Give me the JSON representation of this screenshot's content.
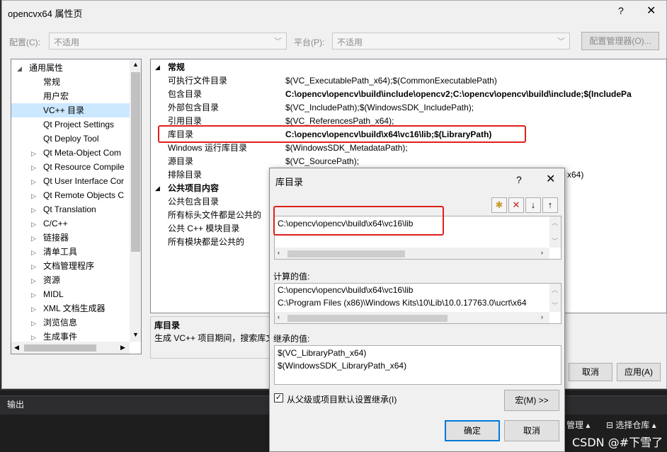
{
  "ide": {
    "output_tab": "输出",
    "status_mgmt": "管理 ▴",
    "status_repo": "⊟ 选择仓库 ▴",
    "watermark": "CSDN @#下雪了"
  },
  "prop_window": {
    "title": "opencvx64 属性页",
    "help": "?",
    "close": "✕",
    "config_label": "配置(C):",
    "config_value": "不适用",
    "platform_label": "平台(P):",
    "platform_value": "不适用",
    "config_manager": "配置管理器(O)...",
    "cancel": "取消",
    "apply": "应用(A)",
    "tree": [
      {
        "label": "通用属性",
        "expander": "◢",
        "level": 0
      },
      {
        "label": "常规",
        "expander": "",
        "level": 1
      },
      {
        "label": "用户宏",
        "expander": "",
        "level": 1
      },
      {
        "label": "VC++ 目录",
        "expander": "",
        "level": 1,
        "selected": true
      },
      {
        "label": "Qt Project Settings",
        "expander": "",
        "level": 1
      },
      {
        "label": "Qt Deploy Tool",
        "expander": "",
        "level": 1
      },
      {
        "label": "Qt Meta-Object Com",
        "expander": "▷",
        "level": 1
      },
      {
        "label": "Qt Resource Compile",
        "expander": "▷",
        "level": 1
      },
      {
        "label": "Qt User Interface Cor",
        "expander": "▷",
        "level": 1
      },
      {
        "label": "Qt Remote Objects C",
        "expander": "▷",
        "level": 1
      },
      {
        "label": "Qt Translation",
        "expander": "▷",
        "level": 1
      },
      {
        "label": "C/C++",
        "expander": "▷",
        "level": 1
      },
      {
        "label": "链接器",
        "expander": "▷",
        "level": 1
      },
      {
        "label": "清单工具",
        "expander": "▷",
        "level": 1
      },
      {
        "label": "文档管理程序",
        "expander": "▷",
        "level": 1
      },
      {
        "label": "资源",
        "expander": "▷",
        "level": 1
      },
      {
        "label": "MIDL",
        "expander": "▷",
        "level": 1
      },
      {
        "label": "XML 文档生成器",
        "expander": "▷",
        "level": 1
      },
      {
        "label": "浏览信息",
        "expander": "▷",
        "level": 1
      },
      {
        "label": "生成事件",
        "expander": "▷",
        "level": 1
      }
    ],
    "grid": [
      {
        "name": "常规",
        "value": "",
        "cat": true
      },
      {
        "name": "可执行文件目录",
        "value": "$(VC_ExecutablePath_x64);$(CommonExecutablePath)"
      },
      {
        "name": "包含目录",
        "value": "C:\\opencv\\opencv\\build\\include\\opencv2;C:\\opencv\\opencv\\build\\include;$(IncludePa",
        "bold": true
      },
      {
        "name": "外部包含目录",
        "value": "$(VC_IncludePath);$(WindowsSDK_IncludePath);"
      },
      {
        "name": "引用目录",
        "value": "$(VC_ReferencesPath_x64);"
      },
      {
        "name": "库目录",
        "value": "C:\\opencv\\opencv\\build\\x64\\vc16\\lib;$(LibraryPath)",
        "bold": true
      },
      {
        "name": "Windows 运行库目录",
        "value": "$(WindowsSDK_MetadataPath);"
      },
      {
        "name": "源目录",
        "value": "$(VC_SourcePath);"
      },
      {
        "name": "排除目录",
        "value": "x64)"
      },
      {
        "name": "公共项目内容",
        "value": "",
        "cat": true
      },
      {
        "name": "公共包含目录",
        "value": ""
      },
      {
        "name": "所有标头文件都是公共的",
        "value": ""
      },
      {
        "name": "公共 C++ 模块目录",
        "value": ""
      },
      {
        "name": "所有模块都是公共的",
        "value": ""
      }
    ],
    "desc_title": "库目录",
    "desc_text": "生成 VC++ 项目期间，搜索库文"
  },
  "dialog": {
    "title": "库目录",
    "help": "?",
    "close": "✕",
    "edit_lines": [
      "C:\\opencv\\opencv\\build\\x64\\vc16\\lib"
    ],
    "computed_label": "计算的值:",
    "computed_lines": [
      "C:\\opencv\\opencv\\build\\x64\\vc16\\lib",
      "C:\\Program Files (x86)\\Windows Kits\\10\\Lib\\10.0.17763.0\\ucrt\\x64"
    ],
    "inherited_label": "继承的值:",
    "inherited_lines": [
      "$(VC_LibraryPath_x64)",
      "$(WindowsSDK_LibraryPath_x64)"
    ],
    "inherit_checkbox": "从父级或项目默认设置继承(I)",
    "inherit_checked": true,
    "macro_button": "宏(M) >>",
    "ok": "确定",
    "cancel": "取消"
  },
  "colors": {
    "highlight": "#e0201c",
    "selected": "#cce8ff"
  }
}
